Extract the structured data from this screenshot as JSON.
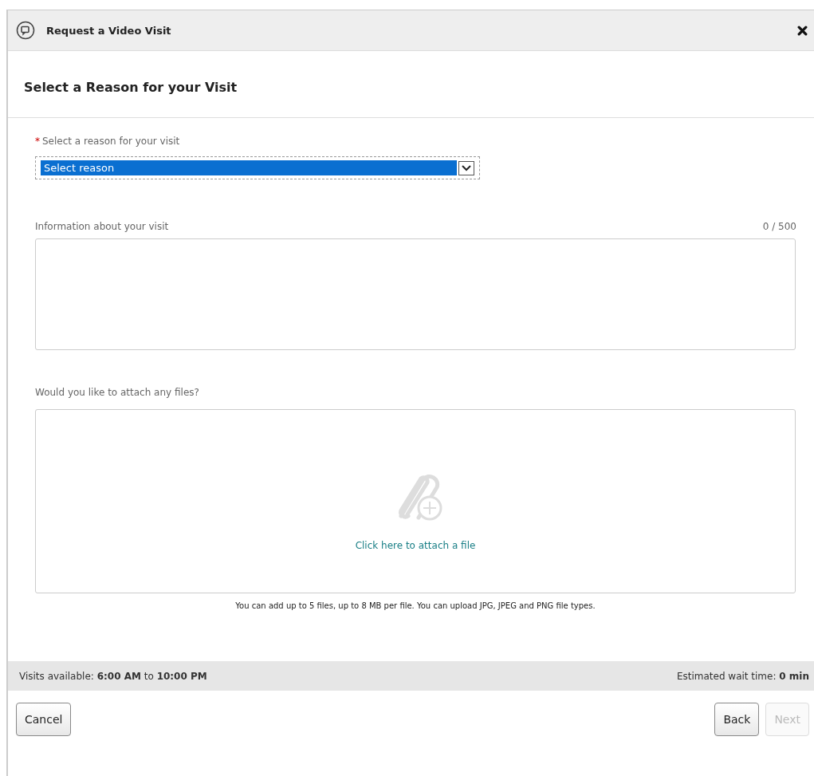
{
  "window": {
    "title": "Request a Video Visit"
  },
  "heading": "Select a Reason for your Visit",
  "reason": {
    "label": "Select a reason for your visit",
    "required_mark": "*",
    "value": "Select reason",
    "selected": true
  },
  "info": {
    "label": "Information about your visit",
    "counter": "0 / 500"
  },
  "attach": {
    "label": "Would you like to attach any files?",
    "link": "Click here to attach a file",
    "hint": "You can add up to 5 files, up to 8 MB per file. You can upload JPG, JPEG and PNG file types."
  },
  "status_bar": {
    "left": "Visits available: **6:00 AM** to **10:00 PM**",
    "right": "Estimated wait time: **0 min**"
  },
  "buttons": [
    {
      "label": "Cancel",
      "kind": "left",
      "disabled": false
    },
    {
      "label": "Back",
      "kind": "right",
      "disabled": false
    },
    {
      "label": "Next",
      "kind": "right",
      "disabled": true
    }
  ]
}
